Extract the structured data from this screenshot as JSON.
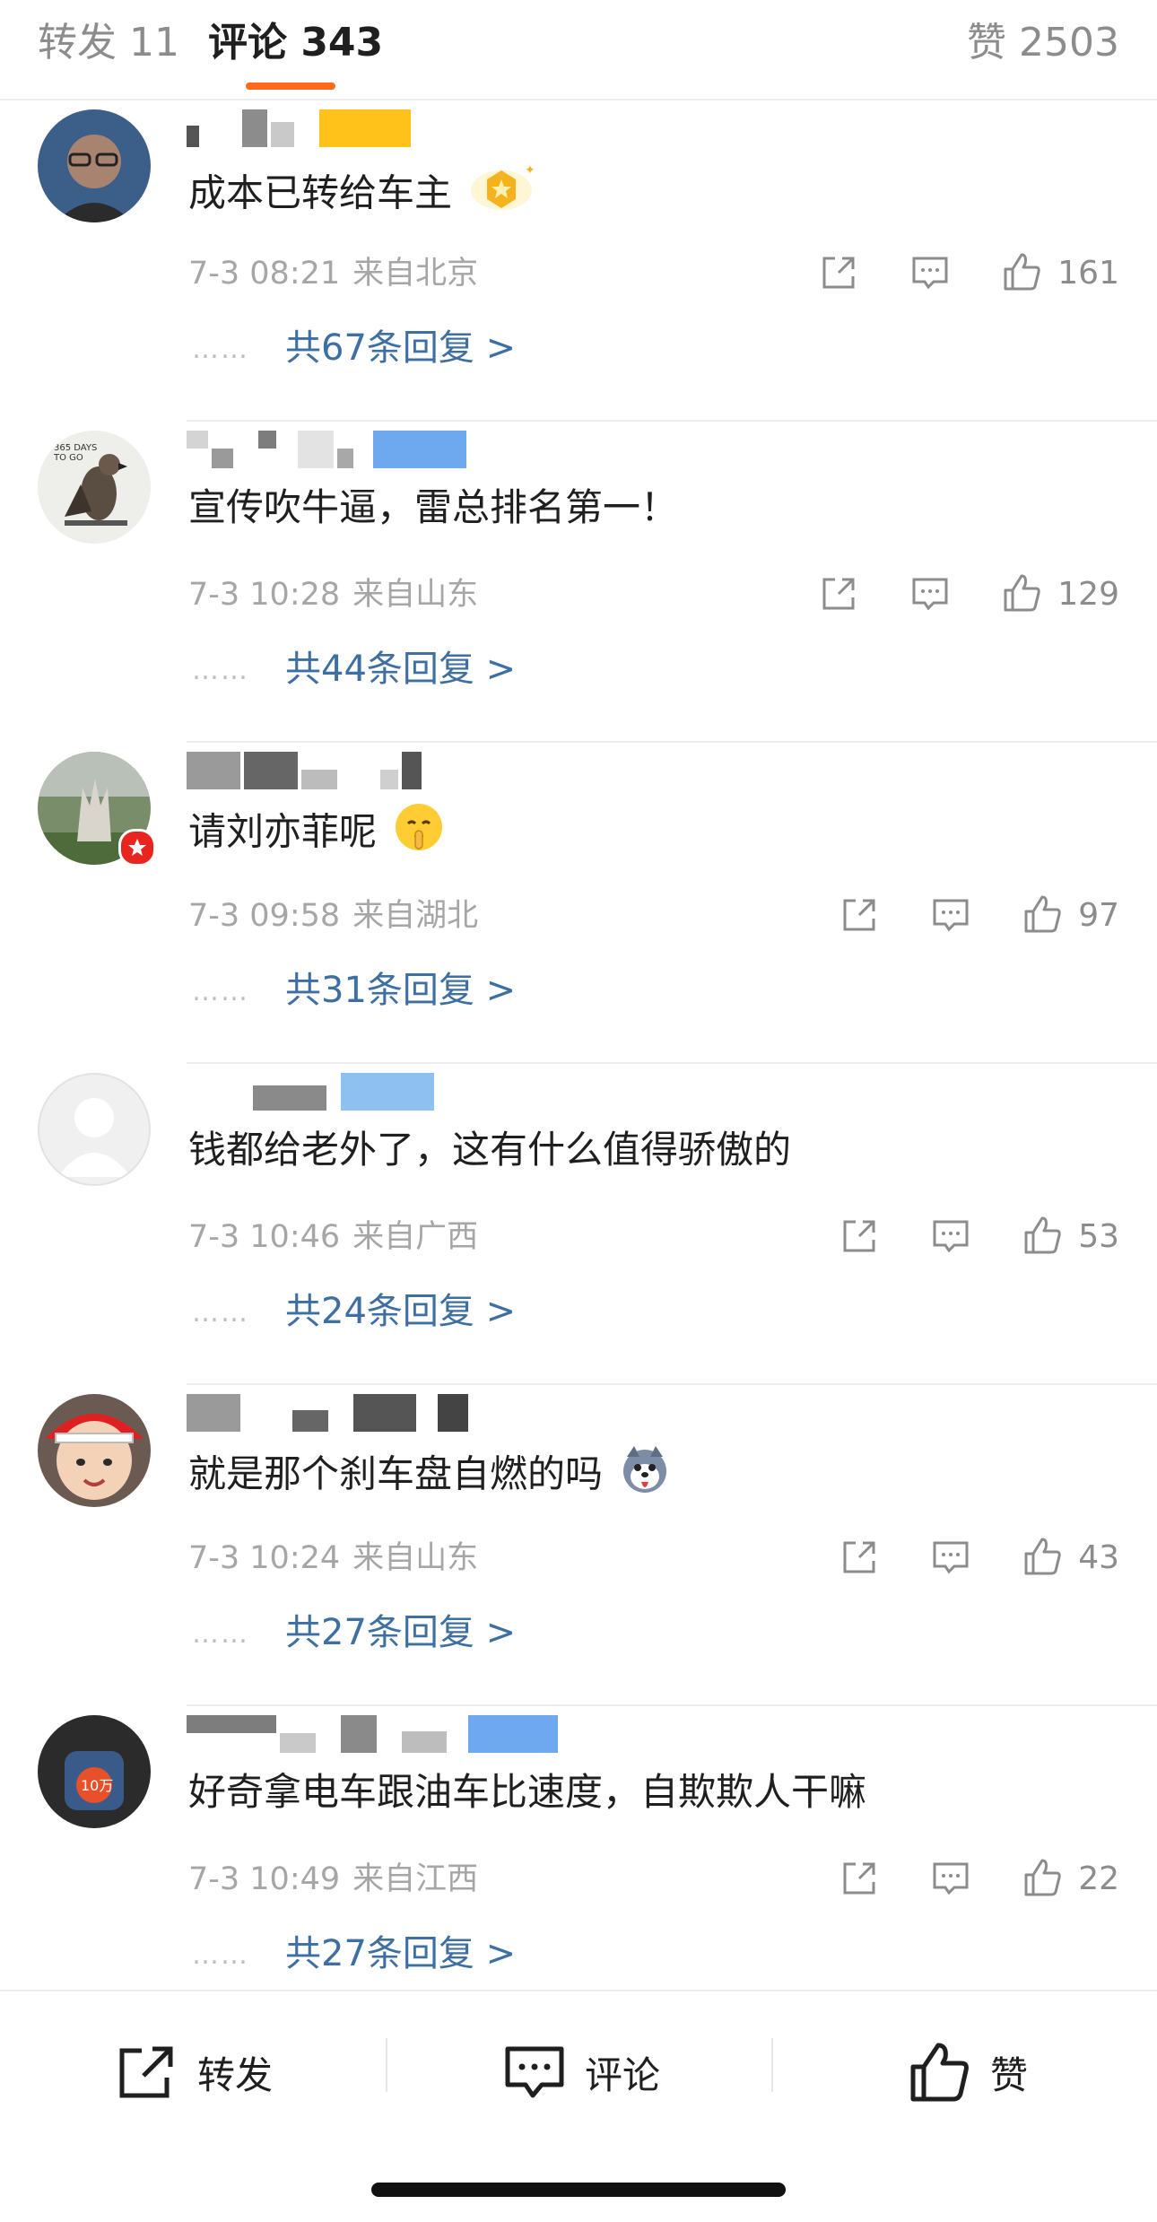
{
  "tabs": {
    "repost": "转发 11",
    "comment": "评论 343",
    "like": "赞 2503"
  },
  "comments": [
    {
      "text": "成本已转给车主",
      "time": "7-3 08:21",
      "location": "来自北京",
      "likes": "161",
      "replies": "共67条回复 >",
      "emoji": "gold-medal-badge-icon"
    },
    {
      "text": "宣传吹牛逼，雷总排名第一！",
      "time": "7-3 10:28",
      "location": "来自山东",
      "likes": "129",
      "replies": "共44条回复 >"
    },
    {
      "text": "请刘亦菲呢",
      "time": "7-3 09:58",
      "location": "来自湖北",
      "likes": "97",
      "replies": "共31条回复 >",
      "emoji": "shush-face-emoji-icon"
    },
    {
      "text": "钱都给老外了，这有什么值得骄傲的",
      "time": "7-3 10:46",
      "location": "来自广西",
      "likes": "53",
      "replies": "共24条回复 >"
    },
    {
      "text": "就是那个刹车盘自燃的吗",
      "time": "7-3 10:24",
      "location": "来自山东",
      "likes": "43",
      "replies": "共27条回复 >",
      "emoji": "husky-dog-emoji-icon"
    },
    {
      "text": "好奇拿电车跟油车比速度，自欺欺人干嘛",
      "time": "7-3 10:49",
      "location": "来自江西",
      "likes": "22",
      "replies": "共27条回复 >"
    }
  ],
  "reply_dots": "……",
  "bottom_bar": {
    "repost_label": "转发",
    "comment_label": "评论",
    "like_label": "赞"
  },
  "colors": {
    "accent": "#ff6a1a",
    "link": "#3e6fa3",
    "muted": "#a6a6a6"
  }
}
